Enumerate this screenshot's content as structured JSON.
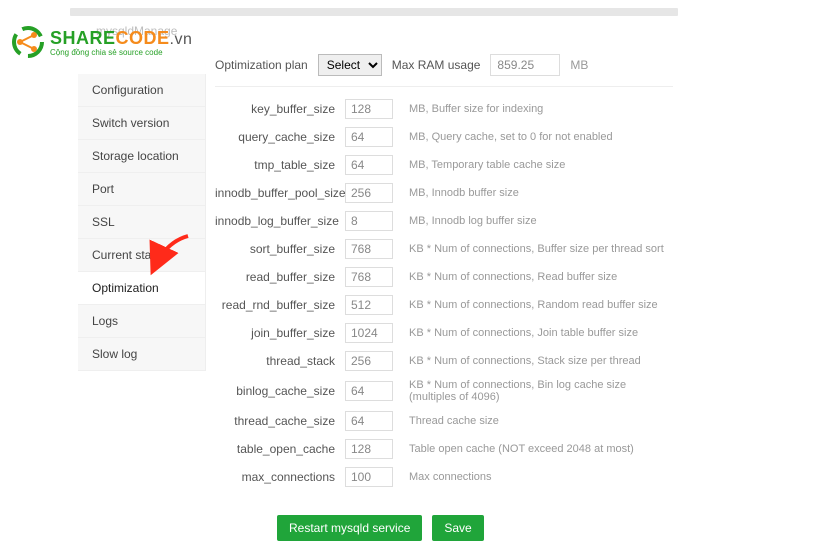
{
  "logo": {
    "share": "SHARE",
    "code": "CODE",
    "vn": ".vn",
    "tagline": "Cộng đồng chia sẻ source code"
  },
  "panel_title": "mysqldManage",
  "sidebar": {
    "items": [
      {
        "label": "Configuration"
      },
      {
        "label": "Switch version"
      },
      {
        "label": "Storage location"
      },
      {
        "label": "Port"
      },
      {
        "label": "SSL"
      },
      {
        "label": "Current status"
      },
      {
        "label": "Optimization"
      },
      {
        "label": "Logs"
      },
      {
        "label": "Slow log"
      }
    ],
    "active_index": 6
  },
  "plan": {
    "label": "Optimization plan",
    "select_placeholder": "Select",
    "ram_label": "Max RAM usage",
    "ram_value": "859.25",
    "ram_unit": "MB"
  },
  "settings": [
    {
      "key": "key_buffer_size",
      "value": "128",
      "hint": "MB, Buffer size for indexing"
    },
    {
      "key": "query_cache_size",
      "value": "64",
      "hint": "MB, Query cache, set to 0 for not enabled"
    },
    {
      "key": "tmp_table_size",
      "value": "64",
      "hint": "MB, Temporary table cache size"
    },
    {
      "key": "innodb_buffer_pool_size",
      "value": "256",
      "hint": "MB, Innodb buffer size"
    },
    {
      "key": "innodb_log_buffer_size",
      "value": "8",
      "hint": "MB, Innodb log buffer size"
    },
    {
      "key": "sort_buffer_size",
      "value": "768",
      "hint": "KB * Num of connections, Buffer size per thread sort"
    },
    {
      "key": "read_buffer_size",
      "value": "768",
      "hint": "KB * Num of connections, Read buffer size"
    },
    {
      "key": "read_rnd_buffer_size",
      "value": "512",
      "hint": "KB * Num of connections, Random read buffer size"
    },
    {
      "key": "join_buffer_size",
      "value": "1024",
      "hint": "KB * Num of connections, Join table buffer size"
    },
    {
      "key": "thread_stack",
      "value": "256",
      "hint": "KB * Num of connections, Stack size per thread"
    },
    {
      "key": "binlog_cache_size",
      "value": "64",
      "hint": "KB * Num of connections, Bin log cache size (multiples of 4096)"
    },
    {
      "key": "thread_cache_size",
      "value": "64",
      "hint": "Thread cache size"
    },
    {
      "key": "table_open_cache",
      "value": "128",
      "hint": "Table open cache (NOT exceed 2048 at most)"
    },
    {
      "key": "max_connections",
      "value": "100",
      "hint": "Max connections"
    }
  ],
  "buttons": {
    "restart": "Restart mysqld service",
    "save": "Save"
  }
}
